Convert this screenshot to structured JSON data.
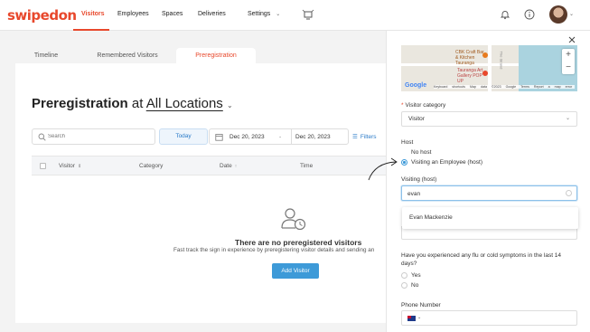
{
  "brand": {
    "logo": "swipedon",
    "accent": "#e8482c",
    "link_blue": "#2b7bc8",
    "button_blue": "#3d9ad8"
  },
  "nav": {
    "items": [
      {
        "label": "Visitors",
        "active": true
      },
      {
        "label": "Employees"
      },
      {
        "label": "Spaces"
      },
      {
        "label": "Deliveries"
      },
      {
        "label": "Settings"
      }
    ]
  },
  "tabs": [
    {
      "label": "Timeline"
    },
    {
      "label": "Remembered Visitors"
    },
    {
      "label": "Preregistration",
      "active": true
    }
  ],
  "page": {
    "title": "Preregistration",
    "at": "at",
    "location": "All Locations"
  },
  "toolbar": {
    "search_placeholder": "Search",
    "today_label": "Today",
    "date_from": "Dec 20, 2023",
    "date_sep": "-",
    "date_to": "Dec 20, 2023",
    "filters_label": "Filters"
  },
  "table": {
    "columns": [
      "Visitor",
      "Category",
      "Date",
      "Time"
    ]
  },
  "empty_state": {
    "title": "There are no preregistered visitors",
    "description": "Fast track the sign in experience by preregistering visitor details and sending an",
    "button": "Add Visitor"
  },
  "panel": {
    "map": {
      "place1": "CBK Craft Bar & Kitchen Tauranga",
      "place2": "Tauranga Art Gallery POP UP",
      "street": "The Strand",
      "zoom_in": "+",
      "zoom_out": "−",
      "google": "Google",
      "attribution": "Keyboard shortcuts  Map data ©2023 Google  Terms  Report a map error"
    },
    "visitor_category": {
      "required_mark": "*",
      "label": "Visitor category",
      "value": "Visitor"
    },
    "host": {
      "label": "Host",
      "options": [
        {
          "label": "No host",
          "selected": false
        },
        {
          "label": "Visiting an Employee (host)",
          "selected": true
        }
      ]
    },
    "visiting_host": {
      "label": "Visiting (host)",
      "value": "evan",
      "suggestion": "Evan Mackenzie"
    },
    "flu_question": {
      "text": "Have you experienced any flu or cold symptoms in the last 14 days?",
      "options": [
        {
          "label": "Yes"
        },
        {
          "label": "No"
        }
      ]
    },
    "phone": {
      "label": "Phone Number"
    }
  }
}
